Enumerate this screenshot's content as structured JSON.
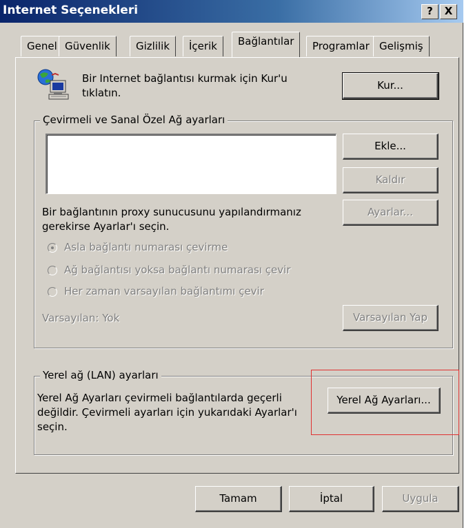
{
  "window": {
    "title": "Internet Seçenekleri",
    "help_button": "?",
    "close_button": "X"
  },
  "tabs": [
    {
      "label": "Genel",
      "active": false
    },
    {
      "label": "Güvenlik",
      "active": false
    },
    {
      "label": "Gizlilik",
      "active": false
    },
    {
      "label": "İçerik",
      "active": false
    },
    {
      "label": "Bağlantılar",
      "active": true
    },
    {
      "label": "Programlar",
      "active": false
    },
    {
      "label": "Gelişmiş",
      "active": false
    }
  ],
  "setup": {
    "text_line1": "Bir Internet bağlantısı kurmak için Kur'u",
    "text_line2": "tıklatın.",
    "button": "Kur...",
    "icon": "network-computer-icon"
  },
  "dialup": {
    "legend": "Çevirmeli ve Sanal Özel Ağ ayarları",
    "add_button": "Ekle...",
    "remove_button": "Kaldır",
    "settings_button": "Ayarlar...",
    "proxy_text_line1": "Bir bağlantının proxy sunucusunu yapılandırmanız",
    "proxy_text_line2": "gerekirse Ayarlar'ı seçin.",
    "radio_never": "Asla bağlantı numarası çevirme",
    "radio_no_network": "Ağ bağlantısı yoksa bağlantı numarası çevir",
    "radio_always": "Her zaman varsayılan bağlantımı çevir",
    "default_label": "Varsayılan:",
    "default_value": "Yok",
    "set_default_button": "Varsayılan Yap"
  },
  "lan": {
    "legend": "Yerel ağ (LAN) ayarları",
    "text_line1": "Yerel Ağ Ayarları çevirmeli bağlantılarda geçerli",
    "text_line2": "değildir. Çevirmeli ayarları için yukarıdaki Ayarlar'ı",
    "text_line3": "seçin.",
    "button": "Yerel Ağ Ayarları..."
  },
  "footer": {
    "ok": "Tamam",
    "cancel": "İptal",
    "apply": "Uygula"
  },
  "colors": {
    "title_bar": "#0a246a",
    "dialog_bg": "#d4d0c8",
    "highlight": "#e03030"
  }
}
